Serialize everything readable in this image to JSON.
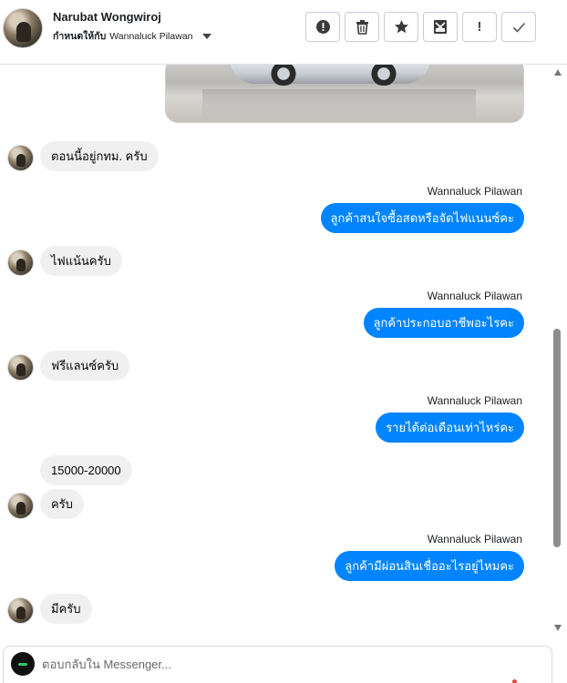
{
  "header": {
    "contact_name": "Narubat Wongwiroj",
    "assign_label": "กำหนดให้กับ",
    "assignee": "Wannaluck Pilawan"
  },
  "actions": [
    {
      "name": "report-icon",
      "label": "Report"
    },
    {
      "name": "trash-icon",
      "label": "Delete"
    },
    {
      "name": "star-icon",
      "label": "Star"
    },
    {
      "name": "spam-icon",
      "label": "Move to spam"
    },
    {
      "name": "exclamation-icon",
      "label": "!"
    },
    {
      "name": "check-icon",
      "label": "Done"
    }
  ],
  "thread": {
    "messages": [
      {
        "dir": "in",
        "text": "ตอนนี้อยู่กทม. ครับ",
        "avatar": true
      },
      {
        "dir": "out",
        "sender": "Wannaluck Pilawan",
        "text": "ลูกค้าสนใจซื้อสดหรือจัดไฟแนนซ์คะ"
      },
      {
        "dir": "in",
        "text": "ไฟแน้นครับ",
        "avatar": true
      },
      {
        "dir": "out",
        "sender": "Wannaluck Pilawan",
        "text": "ลูกค้าประกอบอาชีพอะไรคะ"
      },
      {
        "dir": "in",
        "text": "ฟรีแลนซ์ครับ",
        "avatar": true
      },
      {
        "dir": "out",
        "sender": "Wannaluck Pilawan",
        "text": "รายได้ต่อเดือนเท่าไหร่คะ"
      },
      {
        "dir": "in",
        "text": "15000-20000",
        "avatar": false
      },
      {
        "dir": "in",
        "text": "ครับ",
        "avatar": true
      },
      {
        "dir": "out",
        "sender": "Wannaluck Pilawan",
        "text": "ลูกค้ามีผ่อนสินเชื่ออะไรอยู่ไหมคะ"
      },
      {
        "dir": "in",
        "text": "มีครับ",
        "avatar": true
      }
    ]
  },
  "composer": {
    "placeholder": "ตอบกลับใน Messenger..."
  },
  "colors": {
    "outgoing_bubble": "#0084ff",
    "incoming_bubble": "#f0f0f0"
  }
}
